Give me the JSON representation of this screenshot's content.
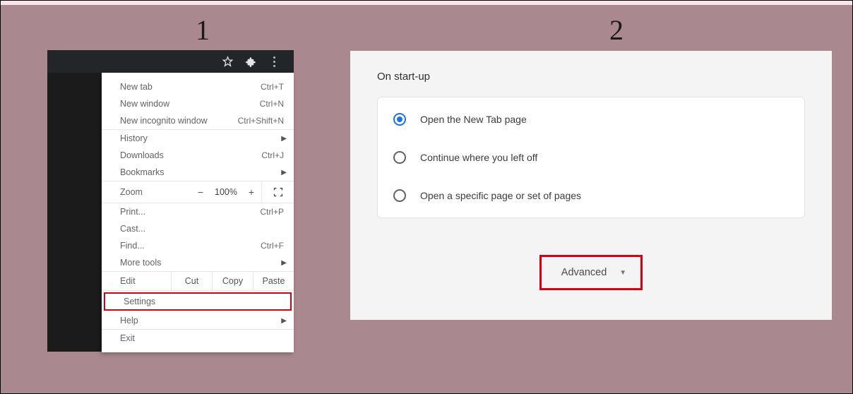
{
  "steps": {
    "one": "1",
    "two": "2"
  },
  "menu": {
    "newtab": {
      "label": "New tab",
      "shortcut": "Ctrl+T"
    },
    "newwindow": {
      "label": "New window",
      "shortcut": "Ctrl+N"
    },
    "incognito": {
      "label": "New incognito window",
      "shortcut": "Ctrl+Shift+N"
    },
    "history": {
      "label": "History"
    },
    "downloads": {
      "label": "Downloads",
      "shortcut": "Ctrl+J"
    },
    "bookmarks": {
      "label": "Bookmarks"
    },
    "zoom": {
      "label": "Zoom",
      "minus": "−",
      "value": "100%",
      "plus": "+"
    },
    "print": {
      "label": "Print...",
      "shortcut": "Ctrl+P"
    },
    "cast": {
      "label": "Cast..."
    },
    "find": {
      "label": "Find...",
      "shortcut": "Ctrl+F"
    },
    "moretools": {
      "label": "More tools"
    },
    "edit": {
      "label": "Edit",
      "cut": "Cut",
      "copy": "Copy",
      "paste": "Paste"
    },
    "settings": {
      "label": "Settings"
    },
    "help": {
      "label": "Help"
    },
    "exit": {
      "label": "Exit"
    }
  },
  "settings": {
    "section_title": "On start-up",
    "options": {
      "newtab": "Open the New Tab page",
      "continue": "Continue where you left off",
      "specific": "Open a specific page or set of pages"
    },
    "advanced_label": "Advanced"
  }
}
